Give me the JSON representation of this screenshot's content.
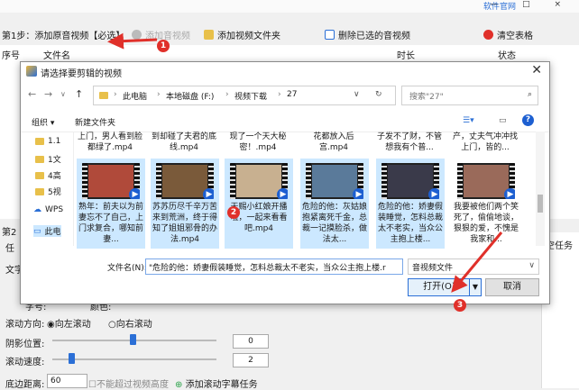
{
  "app": {
    "brand": "软件官网",
    "window_buttons": "— □ ×",
    "step1": "第1步：添加原音视频【必选】",
    "toolbar": {
      "add_av": "添加音视频",
      "add_folder": "添加视频文件夹",
      "delete_selected": "删除已选的音视频",
      "clear_table": "清空表格"
    },
    "table": {
      "col_num": "序号",
      "col_file": "文件名",
      "col_duration": "时长",
      "col_status": "状态"
    },
    "lower": {
      "step2": "第2",
      "task": "任",
      "text": "文字",
      "size_label": "字号:",
      "color_label": "颜色:",
      "scroll_dir_label": "滚动方向:",
      "scroll_left": "向左滚动",
      "scroll_right": "向右滚动",
      "shadow_label": "阴影位置:",
      "shadow_value": "0",
      "speed_label": "滚动速度:",
      "speed_value": "2",
      "bottom_label": "底边距离:",
      "bottom_value": "60",
      "limit_note": "不能超过视频高度",
      "add_task": "添加滚动字幕任务",
      "right_task": "空任务"
    }
  },
  "dialog": {
    "title": "请选择要剪辑的视频",
    "path": [
      "此电脑",
      "本地磁盘 (F:)",
      "视频下载",
      "27"
    ],
    "search_placeholder": "搜索\"27\"",
    "organize": "组织 ▾",
    "new_folder": "新建文件夹",
    "nav": [
      {
        "label": "1.1"
      },
      {
        "label": "1文"
      },
      {
        "label": "4高"
      },
      {
        "label": "5视"
      },
      {
        "label": "WPS"
      },
      {
        "label": "此电"
      }
    ],
    "top_names": [
      "上门，男人看到脸都绿了.mp4",
      "到却碰了夫君的底线.mp4",
      "现了一个天大秘密！.mp4",
      "花都放入后宫.mp4",
      "子发不了财，不管想我有个普...",
      "产，丈夫气冲冲找上门，皆的..."
    ],
    "tiles": [
      {
        "caption": "熟年：前夫以为前妻忘不了自己，上门求复合，哪知前妻...",
        "selected": true,
        "color": "#b04a3a"
      },
      {
        "caption": "苏苏历尽千辛万苦来到荒洲，终于得知了姐姐邪骨的办法.mp4",
        "selected": true,
        "color": "#7a5a3a"
      },
      {
        "caption": "天赐小红娘开播啦，一起来看看吧.mp4",
        "selected": true,
        "color": "#c8b090"
      },
      {
        "caption": "危险的他：灰姑娘抱紧离死千金，总裁一记摸脸杀，做法太...",
        "selected": true,
        "color": "#5a7a9a"
      },
      {
        "caption": "危险的他：娇妻假装睡觉，怎料总裁太不老实，当众公主抱上楼...",
        "selected": true,
        "color": "#3a3a4a"
      },
      {
        "caption": "我要被他们两个笑死了，偷偷地谈，狠狠的爱，不愧是我家和...",
        "selected": false,
        "color": "#9a6a5a"
      }
    ],
    "filename_label": "文件名(N):",
    "filename_value": "\"危险的他：娇妻假装睡觉，怎料总裁太不老实，当众公主抱上楼.r",
    "filetype": "音视频文件",
    "open": "打开(O)",
    "cancel": "取消"
  },
  "annotations": {
    "n1": "1",
    "n2": "2",
    "n3": "3"
  },
  "colors": {
    "accent": "#2b6fd6",
    "marker": "#e0302a",
    "selection": "#cce8ff"
  }
}
